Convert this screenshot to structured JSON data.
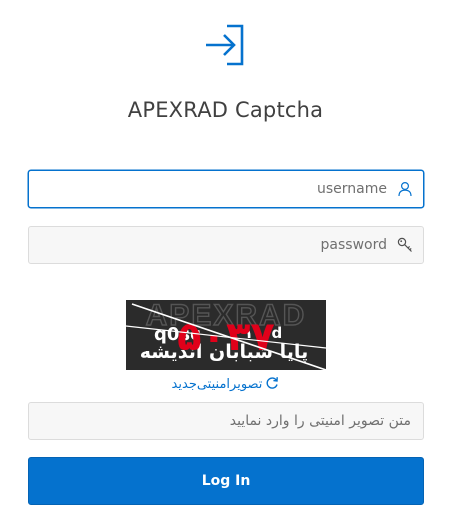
{
  "app": {
    "title": "APEXRAD Captcha"
  },
  "colors": {
    "accent": "#0572ce",
    "text": "#404040",
    "field_bg": "#f7f7f7",
    "field_border": "#dcdcdc",
    "captcha_bg": "#2a2a2a",
    "captcha_red": "#e0001a"
  },
  "form": {
    "username": {
      "value": "",
      "placeholder": "username",
      "icon": "user-icon"
    },
    "password": {
      "value": "",
      "placeholder": "password",
      "icon": "key-icon"
    },
    "captcha": {
      "image": {
        "background_word": "APEXRAD",
        "code_text": "q0sc",
        "overlay_text": "۵۰۳۷",
        "small_text": "۱۰۰d",
        "bottom_text": "پایا شبابان اندیشه"
      },
      "refresh_label": "تصویرامنیتی‌جدید",
      "refresh_icon": "refresh-icon",
      "value": "",
      "placeholder": "متن تصویر امنیتی را وارد نمایید"
    },
    "login_label": "Log In"
  }
}
